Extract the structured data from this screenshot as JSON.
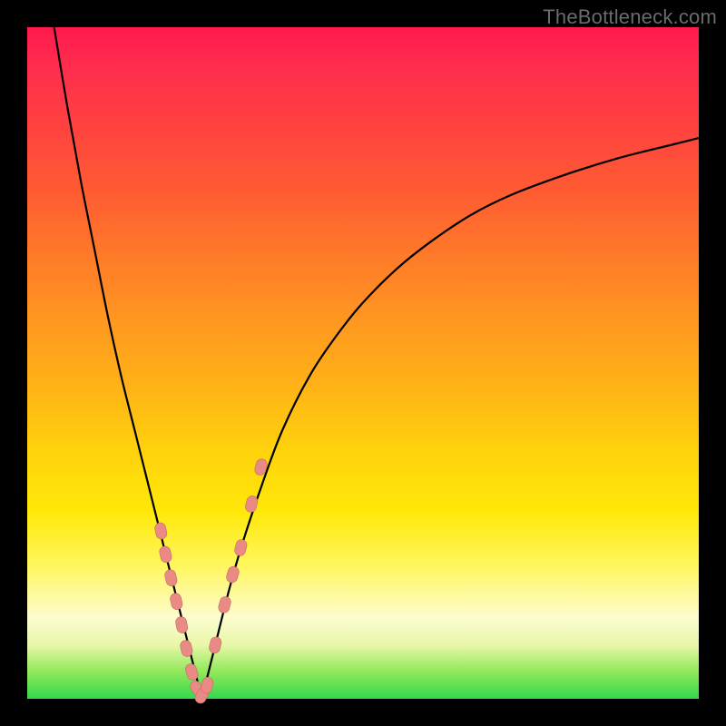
{
  "watermark": {
    "text": "TheBottleneck.com"
  },
  "colors": {
    "background": "#000000",
    "curve": "#000000",
    "marker_fill": "#e98b84",
    "marker_stroke": "#c26b63",
    "gradient_stops": [
      "#ff1a4d",
      "#ff2d4d",
      "#ff4040",
      "#ff5a33",
      "#ff7a29",
      "#ff9820",
      "#ffb416",
      "#ffd20c",
      "#ffe808",
      "#fff65c",
      "#fdfccf",
      "#e8f7a8",
      "#8fe85a",
      "#33d84e"
    ]
  },
  "chart_data": {
    "type": "line",
    "title": "",
    "xlabel": "",
    "ylabel": "",
    "xlim": [
      0,
      100
    ],
    "ylim": [
      0,
      100
    ],
    "grid": false,
    "legend": false,
    "series": [
      {
        "name": "left-branch",
        "x": [
          4,
          6,
          8,
          10,
          12,
          14,
          16,
          18,
          20,
          21,
          22,
          23,
          24,
          25,
          26
        ],
        "y": [
          100,
          88,
          77,
          67,
          57,
          48,
          40,
          32,
          24,
          20,
          16,
          12,
          8,
          4,
          0
        ]
      },
      {
        "name": "right-branch",
        "x": [
          26,
          28,
          30,
          32,
          35,
          38,
          42,
          46,
          50,
          55,
          60,
          66,
          72,
          80,
          88,
          96,
          100
        ],
        "y": [
          0,
          8,
          16,
          23,
          32,
          40,
          48,
          54,
          59,
          64,
          68,
          72,
          75,
          78,
          80.5,
          82.5,
          83.5
        ]
      }
    ],
    "markers": {
      "name": "scatter-points",
      "x": [
        19.9,
        20.6,
        21.4,
        22.2,
        23.0,
        23.7,
        24.5,
        25.3,
        26.0,
        26.8,
        28.0,
        29.4,
        30.6,
        31.8,
        33.4,
        34.8
      ],
      "y": [
        25.0,
        21.5,
        18.0,
        14.5,
        11.0,
        7.5,
        4.0,
        1.5,
        0.5,
        2.0,
        8.0,
        14.0,
        18.5,
        22.5,
        29.0,
        34.5
      ]
    }
  }
}
